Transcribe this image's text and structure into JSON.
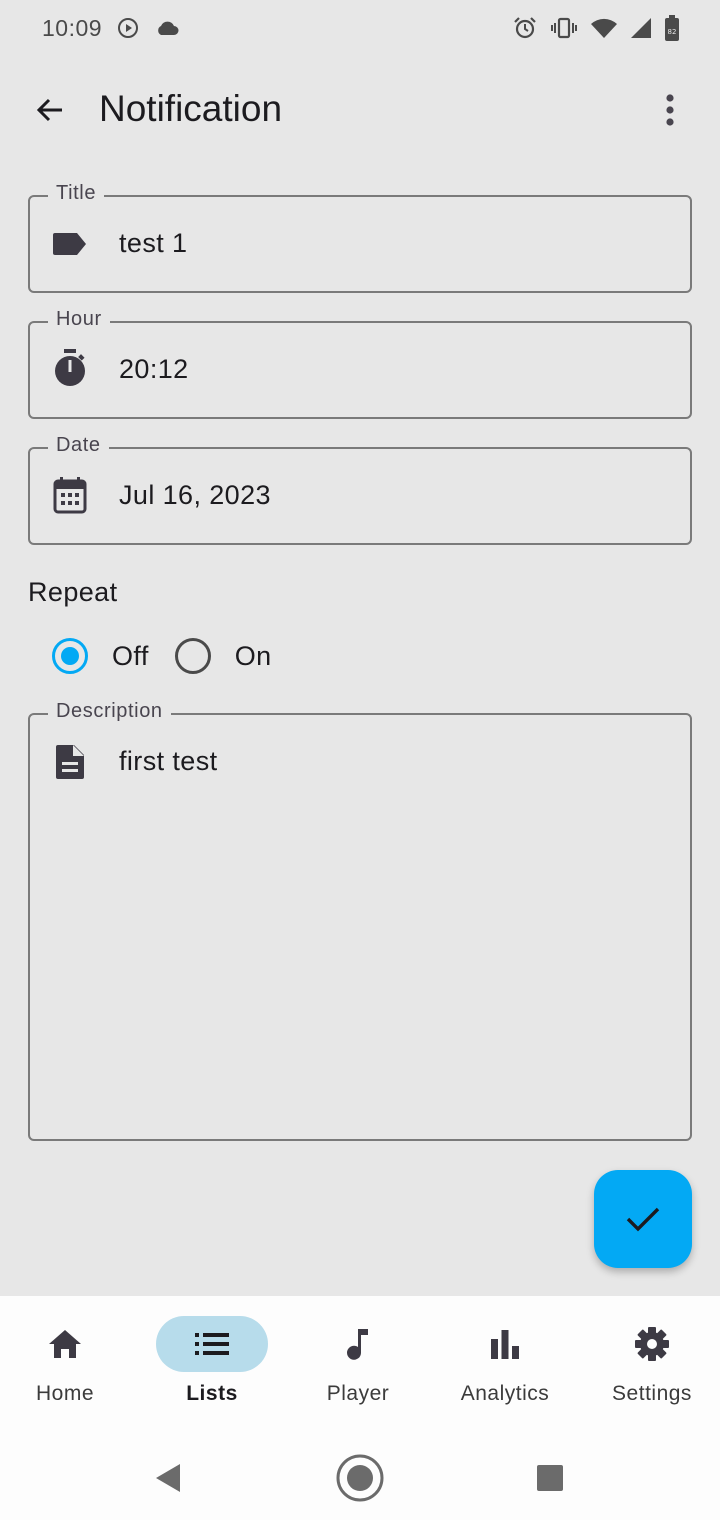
{
  "status_bar": {
    "time": "10:09",
    "icons": [
      "play-circle-icon",
      "cloud-icon",
      "alarm-icon",
      "vibrate-icon",
      "wifi-icon",
      "signal-icon",
      "battery-icon"
    ],
    "battery_level": "82"
  },
  "app_bar": {
    "title": "Notification",
    "back_icon": "arrow-back-icon",
    "menu_icon": "more-vert-icon"
  },
  "form": {
    "title": {
      "label": "Title",
      "value": "test 1",
      "icon": "label-icon"
    },
    "hour": {
      "label": "Hour",
      "value": "20:12",
      "icon": "timer-icon"
    },
    "date": {
      "label": "Date",
      "value": "Jul 16, 2023",
      "icon": "calendar-icon"
    },
    "repeat": {
      "label": "Repeat",
      "options": [
        {
          "label": "Off",
          "selected": true
        },
        {
          "label": "On",
          "selected": false
        }
      ]
    },
    "description": {
      "label": "Description",
      "value": "first test",
      "icon": "description-icon"
    }
  },
  "fab": {
    "icon": "check-icon",
    "color": "#03a9f4"
  },
  "bottom_nav": {
    "items": [
      {
        "label": "Home",
        "icon": "home-icon",
        "active": false
      },
      {
        "label": "Lists",
        "icon": "list-icon",
        "active": true
      },
      {
        "label": "Player",
        "icon": "music-note-icon",
        "active": false
      },
      {
        "label": "Analytics",
        "icon": "bar-chart-icon",
        "active": false
      },
      {
        "label": "Settings",
        "icon": "gear-icon",
        "active": false
      }
    ]
  },
  "system_nav": [
    "back-triangle-icon",
    "home-circle-icon",
    "recents-square-icon"
  ],
  "colors": {
    "accent": "#03a9f4",
    "background": "#e7e7e7",
    "nav_pill": "#b7dceb"
  }
}
